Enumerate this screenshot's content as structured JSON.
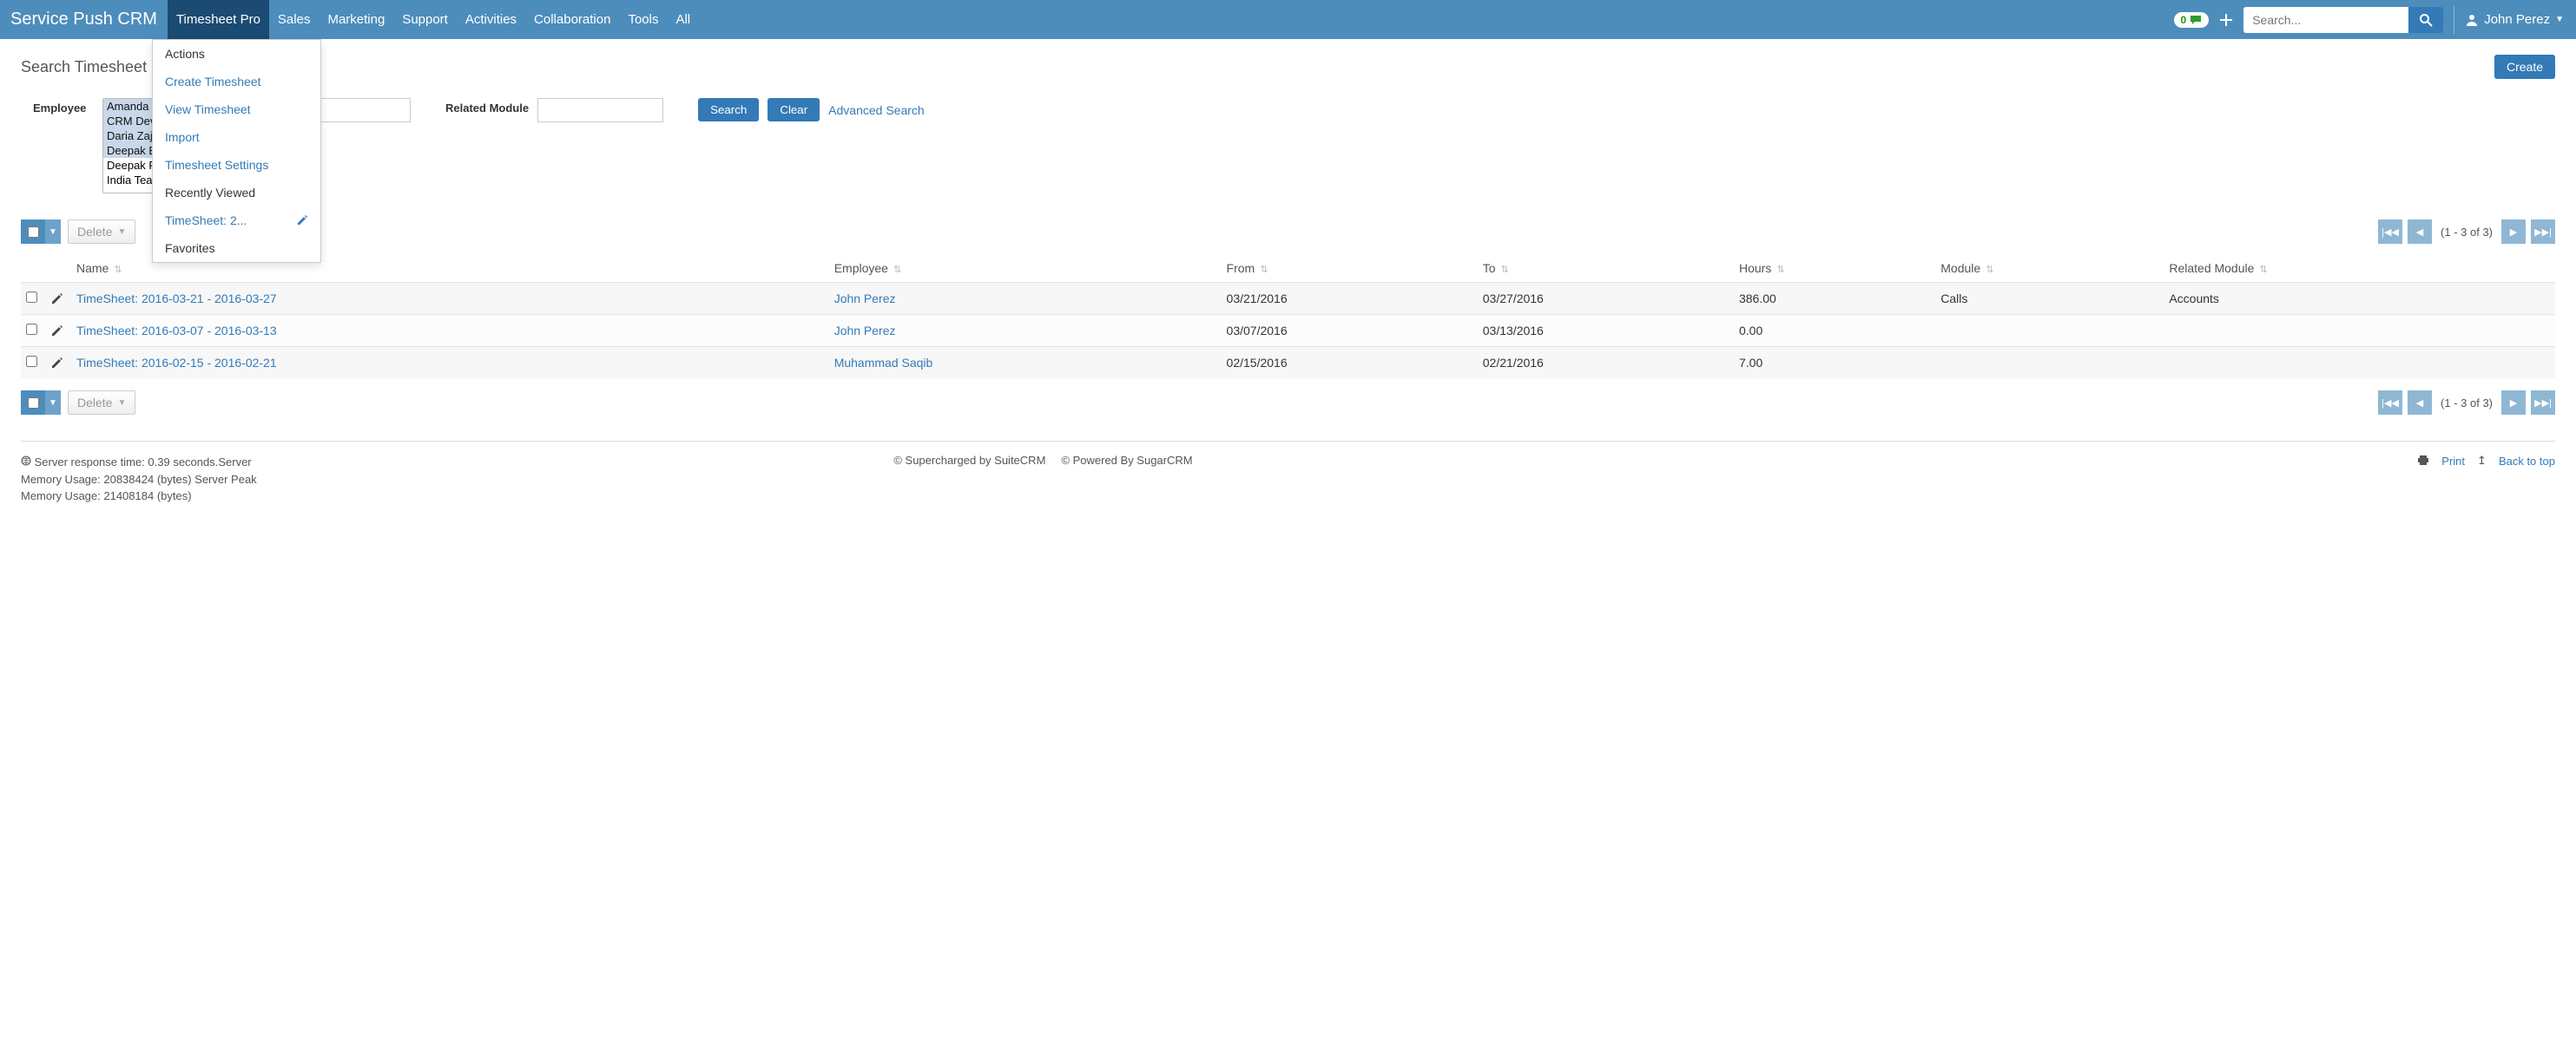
{
  "brand": "Service Push CRM",
  "nav": [
    "Timesheet Pro",
    "Sales",
    "Marketing",
    "Support",
    "Activities",
    "Collaboration",
    "Tools",
    "All"
  ],
  "nav_active": 0,
  "notif_count": "0",
  "search_placeholder": "Search...",
  "user_name": "John Perez",
  "dropdown": {
    "actions_header": "Actions",
    "items": [
      "Create Timesheet",
      "View Timesheet",
      "Import",
      "Timesheet Settings"
    ],
    "recently_header": "Recently Viewed",
    "recent_item": "TimeSheet: 2...",
    "favorites_header": "Favorites"
  },
  "page_title": "Search Timesheet Pro",
  "create_btn": "Create",
  "search_panel": {
    "employee_label": "Employee",
    "employee_options": [
      "Amanda M",
      "CRM Dev",
      "Daria Zaja",
      "Deepak B",
      "Deepak P",
      "India Tear"
    ],
    "related_label": "Related Module",
    "search_btn": "Search",
    "clear_btn": "Clear",
    "advanced": "Advanced Search"
  },
  "toolbar": {
    "delete": "Delete",
    "pager_text": "(1 - 3 of 3)"
  },
  "columns": [
    "Name",
    "Employee",
    "From",
    "To",
    "Hours",
    "Module",
    "Related Module"
  ],
  "rows": [
    {
      "name": "TimeSheet: 2016-03-21 - 2016-03-27",
      "employee": "John Perez",
      "from": "03/21/2016",
      "to": "03/27/2016",
      "hours": "386.00",
      "module": "Calls",
      "related": "Accounts"
    },
    {
      "name": "TimeSheet: 2016-03-07 - 2016-03-13",
      "employee": "John Perez",
      "from": "03/07/2016",
      "to": "03/13/2016",
      "hours": "0.00",
      "module": "",
      "related": ""
    },
    {
      "name": "TimeSheet: 2016-02-15 - 2016-02-21",
      "employee": "Muhammad Saqib",
      "from": "02/15/2016",
      "to": "02/21/2016",
      "hours": "7.00",
      "module": "",
      "related": ""
    }
  ],
  "footer": {
    "server": "Server response time: 0.39 seconds.Server Memory Usage: 20838424 (bytes) Server Peak Memory Usage: 21408184 (bytes)",
    "supercharged": "© Supercharged by SuiteCRM",
    "powered": "© Powered By SugarCRM",
    "print": "Print",
    "back_to_top": "Back to top"
  }
}
